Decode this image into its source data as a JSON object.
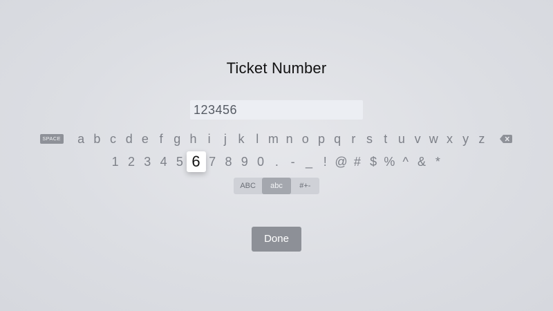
{
  "title": "Ticket Number",
  "input": {
    "value": "123456"
  },
  "keyboard": {
    "space_label": "SPACE",
    "delete_icon": "backspace-icon",
    "letters": [
      "a",
      "b",
      "c",
      "d",
      "e",
      "f",
      "g",
      "h",
      "i",
      "j",
      "k",
      "l",
      "m",
      "n",
      "o",
      "p",
      "q",
      "r",
      "s",
      "t",
      "u",
      "v",
      "w",
      "x",
      "y",
      "z"
    ],
    "symbols": [
      "1",
      "2",
      "3",
      "4",
      "5",
      "6",
      "7",
      "8",
      "9",
      "0",
      ".",
      "-",
      "_",
      "!",
      "@",
      "#",
      "$",
      "%",
      "^",
      "&",
      "*"
    ],
    "focused_key": "6",
    "modes": [
      "ABC",
      "abc",
      "#+-"
    ],
    "selected_mode": "abc"
  },
  "done_label": "Done",
  "colors": {
    "background": "#dcdee3",
    "focused_key": "#ffffff",
    "done_button": "#8d9097"
  }
}
